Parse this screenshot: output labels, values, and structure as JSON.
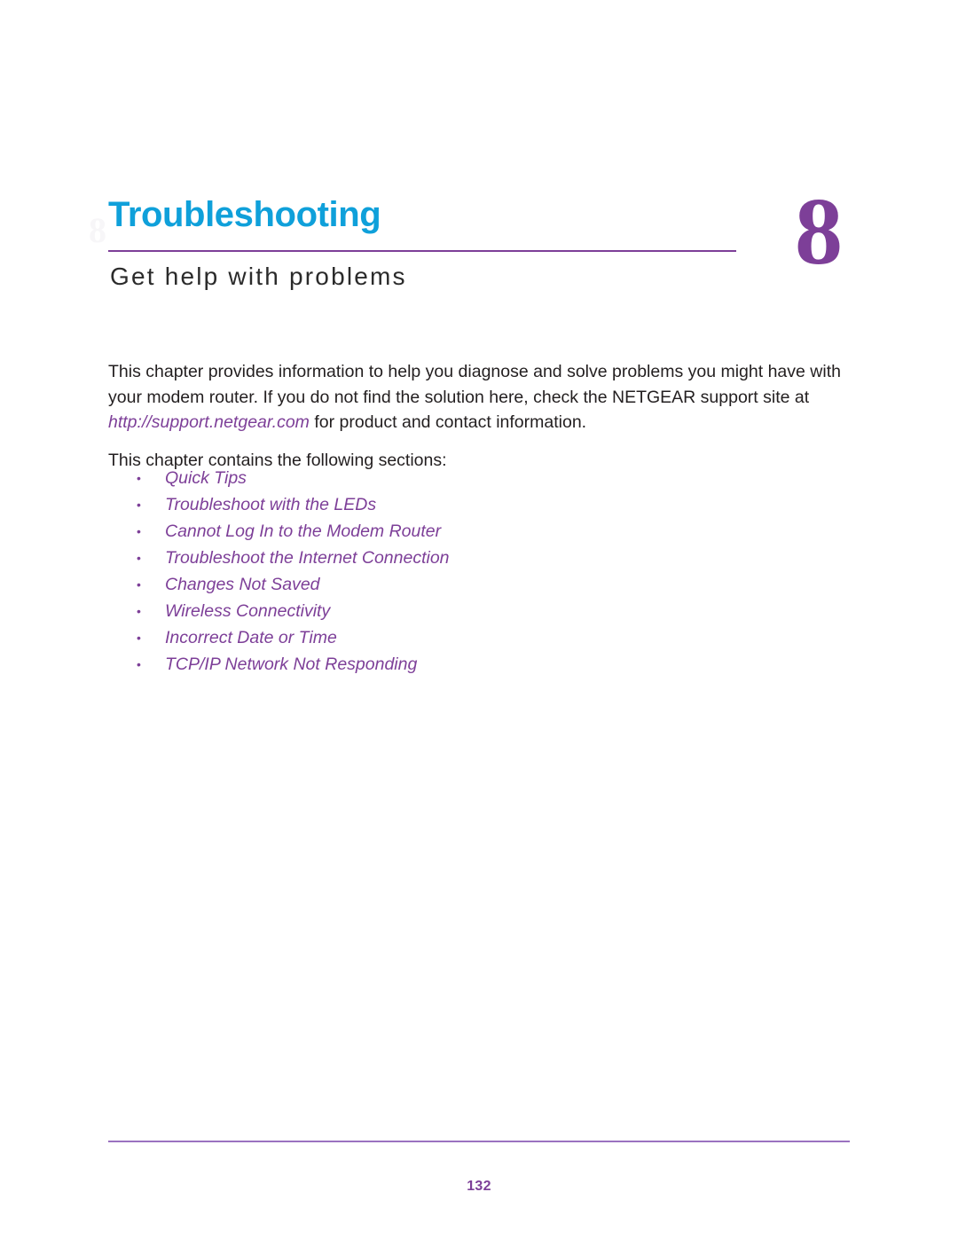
{
  "document": {
    "background_color": "#ffffff",
    "accent_blue": "#0fa0da",
    "accent_purple": "#7d3f98",
    "body_text_color": "#231f20"
  },
  "chapter": {
    "title": "Troubleshooting",
    "subtitle": "Get help with problems",
    "number": "8",
    "ghost_number": "8"
  },
  "intro": {
    "paragraph_before_link": "This chapter provides information to help you diagnose and solve problems you might have with your modem router. If you do not find the solution here, check the NETGEAR support site at ",
    "link_text": "http://support.netgear.com",
    "paragraph_after_link": " for product and contact information.",
    "contains_line": "This chapter contains the following sections:"
  },
  "sections": {
    "bullet_glyph": "•",
    "items": [
      {
        "label": "Quick Tips"
      },
      {
        "label": "Troubleshoot with the LEDs"
      },
      {
        "label": "Cannot Log In to the Modem Router"
      },
      {
        "label": "Troubleshoot the Internet Connection"
      },
      {
        "label": "Changes Not Saved"
      },
      {
        "label": "Wireless Connectivity"
      },
      {
        "label": "Incorrect Date or Time"
      },
      {
        "label": "TCP/IP Network Not Responding"
      }
    ]
  },
  "footer": {
    "page_number": "132"
  }
}
